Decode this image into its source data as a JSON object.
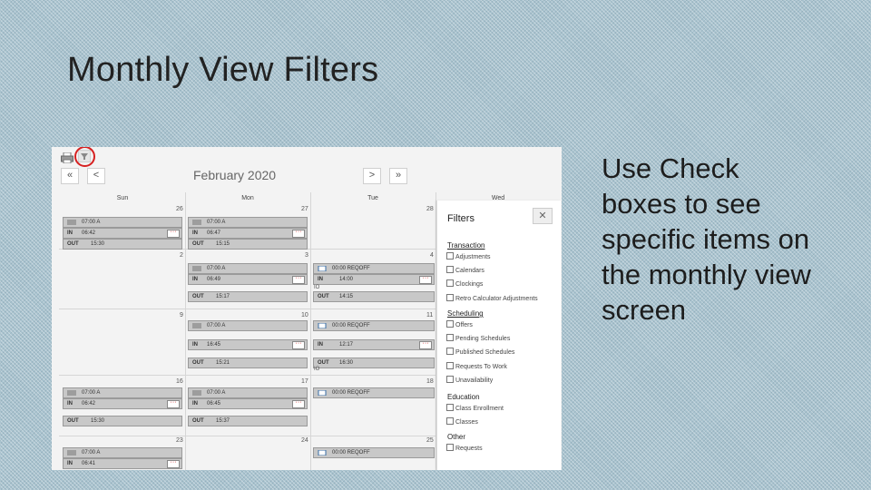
{
  "slide": {
    "title": "Monthly View Filters",
    "side_text": "Use Check boxes to see specific items on the monthly view screen"
  },
  "toolbar": {
    "first_label": "«",
    "prev_label": "<",
    "month": "February 2020",
    "next_label": ">",
    "last_label": "»"
  },
  "days": [
    "Sun",
    "Mon",
    "Tue",
    "Wed"
  ],
  "day_numbers": {
    "w0": [
      "26",
      "27",
      "28"
    ],
    "w1": [
      "2",
      "3",
      "4"
    ],
    "w2": [
      "9",
      "10",
      "11"
    ],
    "w3": [
      "16",
      "17",
      "18"
    ],
    "w4": [
      "23",
      "24",
      "25"
    ]
  },
  "entries": {
    "sun_w0_shift": "07:00 A",
    "sun_w0_in_k": "IN",
    "sun_w0_in_v": "06:42",
    "sun_w0_out_k": "OUT",
    "sun_w0_out_v": "15:30",
    "mon_w0_shift": "07:00 A",
    "mon_w0_in_k": "IN",
    "mon_w0_in_v": "06:47",
    "mon_w0_out_k": "OUT",
    "mon_w0_out_v": "15:15",
    "mon_w1_shift": "07:00 A",
    "mon_w1_in_k": "IN",
    "mon_w1_in_v": "06:49",
    "mon_w1_out_k": "OUT",
    "mon_w1_out_v": "15:17",
    "tue_w1_req": "00:00 REQOFF",
    "tue_w1_in_k": "IN",
    "tue_w1_in_v": "14:00",
    "tue_w1_out_k": "OUT",
    "tue_w1_out_v": "14:15",
    "tue_w1_io": "IO",
    "mon_w2_shift": "07:00 A",
    "mon_w2_in_k": "IN",
    "mon_w2_in_v": "16:45",
    "mon_w2_out_k": "OUT",
    "mon_w2_out_v": "15:21",
    "tue_w2_req": "00:00 REQOFF",
    "tue_w2_in_k": "IN",
    "tue_w2_in_v": "12:17",
    "tue_w2_out_k": "OUT",
    "tue_w2_out_v": "16:30",
    "tue_w2_io": "IO",
    "sun_w3_shift": "07:00 A",
    "sun_w3_in_k": "IN",
    "sun_w3_in_v": "06:42",
    "sun_w3_out_k": "OUT",
    "sun_w3_out_v": "15:30",
    "mon_w3_shift": "07:00 A",
    "mon_w3_in_k": "IN",
    "mon_w3_in_v": "06:45",
    "mon_w3_out_k": "OUT",
    "mon_w3_out_v": "15:37",
    "tue_w3_req": "00:00 REQOFF",
    "sun_w4_shift": "07:00 A",
    "sun_w4_in_k": "IN",
    "sun_w4_in_v": "06:41",
    "tue_w4_req": "00:00 REQOFF"
  },
  "filters": {
    "title": "Filters",
    "close": "✕",
    "sections": {
      "transaction": "Transaction",
      "scheduling": "Scheduling",
      "education": "Education",
      "other": "Other"
    },
    "items": {
      "adjustments": "Adjustments",
      "calendars": "Calendars",
      "clockings": "Clockings",
      "retro": "Retro Calculator Adjustments",
      "offers": "Offers",
      "pending_schedules": "Pending Schedules",
      "published_schedules": "Published Schedules",
      "requests_to_work": "Requests To Work",
      "unavailability": "Unavailability",
      "class_enrollment": "Class Enrollment",
      "classes": "Classes",
      "requests": "Requests"
    }
  },
  "colors": {
    "highlight_circle": "#d62020",
    "bar_fill": "#c8c8c8"
  }
}
